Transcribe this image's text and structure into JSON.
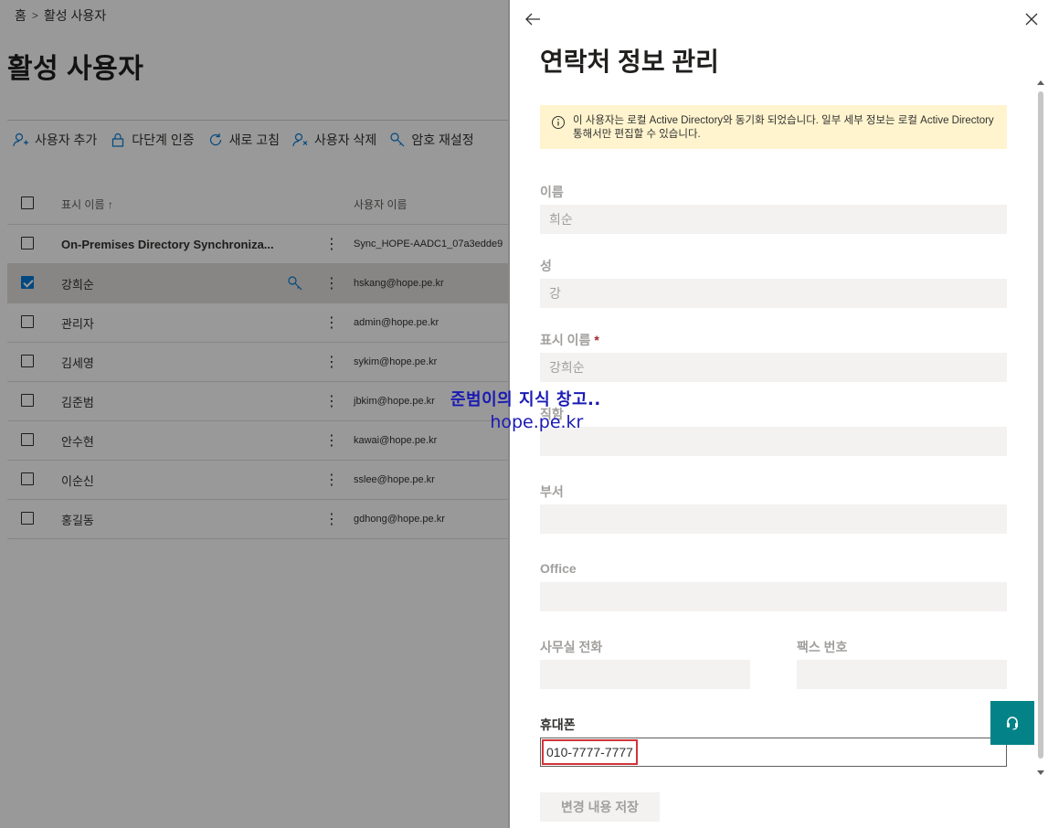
{
  "breadcrumb": {
    "home": "홈",
    "current": "활성 사용자"
  },
  "page_title": "활성 사용자",
  "commands": [
    {
      "label": "사용자 추가",
      "icon": "add-user-icon"
    },
    {
      "label": "다단계 인증",
      "icon": "lock-icon"
    },
    {
      "label": "새로 고침",
      "icon": "refresh-icon"
    },
    {
      "label": "사용자 삭제",
      "icon": "delete-user-icon"
    },
    {
      "label": "암호 재설정",
      "icon": "key-icon"
    }
  ],
  "table": {
    "col_display_name": "표시 이름 ↑",
    "col_username": "사용자 이름",
    "rows": [
      {
        "name": "On-Premises Directory Synchroniza...",
        "user": "Sync_HOPE-AADC1_07a3edde9",
        "selected": false
      },
      {
        "name": "강희순",
        "user": "hskang@hope.pe.kr",
        "selected": true
      },
      {
        "name": "관리자",
        "user": "admin@hope.pe.kr",
        "selected": false
      },
      {
        "name": "김세영",
        "user": "sykim@hope.pe.kr",
        "selected": false
      },
      {
        "name": "김준범",
        "user": "jbkim@hope.pe.kr",
        "selected": false
      },
      {
        "name": "안수현",
        "user": "kawai@hope.pe.kr",
        "selected": false
      },
      {
        "name": "이순신",
        "user": "sslee@hope.pe.kr",
        "selected": false
      },
      {
        "name": "홍길동",
        "user": "gdhong@hope.pe.kr",
        "selected": false
      }
    ]
  },
  "panel": {
    "title": "연락처 정보 관리",
    "info": "이 사용자는 로컬 Active Directory와 동기화 되었습니다. 일부 세부 정보는 로컬 Active Directory 통해서만 편집할 수 있습니다.",
    "fields": {
      "first_name": {
        "label": "이름",
        "value": "희순"
      },
      "last_name": {
        "label": "성",
        "value": "강"
      },
      "display_name": {
        "label": "표시 이름",
        "required": "*",
        "value": "강희순"
      },
      "job_title": {
        "label": "직함",
        "value": ""
      },
      "department": {
        "label": "부서",
        "value": ""
      },
      "office": {
        "label": "Office",
        "value": ""
      },
      "office_phone": {
        "label": "사무실 전화",
        "value": ""
      },
      "fax": {
        "label": "팩스 번호",
        "value": ""
      },
      "mobile": {
        "label": "휴대폰",
        "value": "010-7777-7777"
      }
    },
    "save_label": "변경 내용 저장"
  },
  "watermark": {
    "line1": "준범이의 지식 창고..",
    "line2": "hope.pe.kr"
  },
  "colors": {
    "accent": "#0078d4",
    "info_bg": "#fff4ce",
    "help_fab": "#038387",
    "highlight": "#d13438"
  }
}
